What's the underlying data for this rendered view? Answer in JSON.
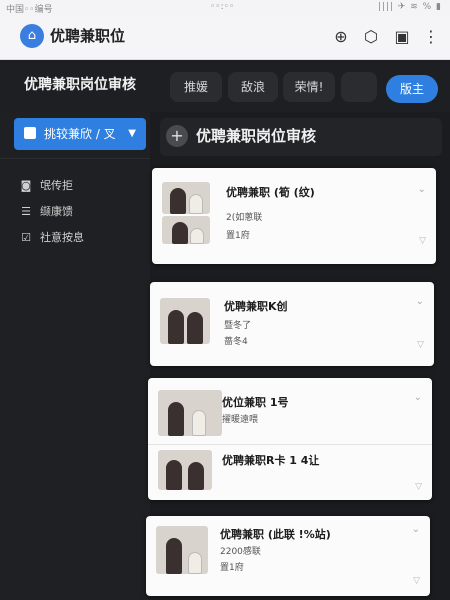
{
  "status_bar": {
    "left": "中国◦◦编号",
    "center": "◦◦:◦◦",
    "right": "|||| ✈ ≋ % ▮"
  },
  "app": {
    "title": "优聘兼职位",
    "icon": "app-logo-icon"
  },
  "toolbar": {
    "icons": [
      "search-icon",
      "settings-icon",
      "box-icon",
      "more-icon"
    ]
  },
  "header": {
    "title": "优聘兼职岗位审核",
    "tabs": [
      "推媛",
      "敌浪",
      "荣情!",
      ""
    ],
    "primary_button": "版主"
  },
  "sidebar": {
    "select_label": "挑较兼欣 / 叉",
    "items": [
      {
        "label": "氓传拒",
        "icon": "camera-icon"
      },
      {
        "label": "缬康馈",
        "icon": "list-icon"
      },
      {
        "label": "社意按息",
        "icon": "check-icon"
      }
    ]
  },
  "main": {
    "title": "优聘兼职岗位审核"
  },
  "cards": [
    {
      "title": "优聘兼职 (筍 (纹)",
      "line1": "2(如蔥联",
      "line2": "置1府"
    },
    {
      "title": "优聘兼职K创",
      "line1": "暨冬了",
      "line2": "蔷冬4"
    },
    {
      "title": "优位兼职 1号",
      "line1": "擢暖遠喂",
      "subtitle2": "优聘兼职R卡 1 4让"
    },
    {
      "title": "优聘兼职 (此联 !%站)",
      "line1": "2200感联",
      "line2": "置1府"
    }
  ]
}
